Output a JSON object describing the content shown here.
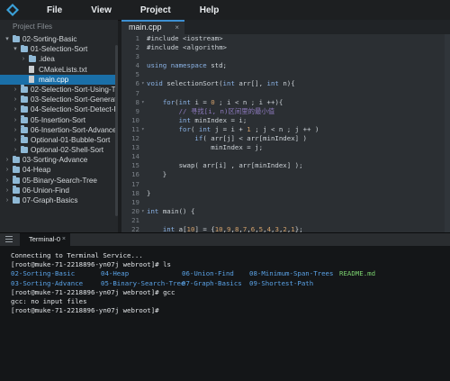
{
  "menu": {
    "items": [
      "File",
      "View",
      "Project",
      "Help"
    ]
  },
  "sidebar": {
    "header": "Project Files",
    "items": [
      {
        "label": "02-Sorting-Basic",
        "level": 0,
        "type": "folder",
        "expanded": true,
        "selected": false
      },
      {
        "label": "01-Selection-Sort",
        "level": 1,
        "type": "folder",
        "expanded": true,
        "selected": false
      },
      {
        "label": ".idea",
        "level": 2,
        "type": "folder",
        "expanded": false,
        "selected": false
      },
      {
        "label": "CMakeLists.txt",
        "level": 2,
        "type": "file",
        "selected": false
      },
      {
        "label": "main.cpp",
        "level": 2,
        "type": "file",
        "selected": true
      },
      {
        "label": "02-Selection-Sort-Using-Te",
        "level": 1,
        "type": "folder",
        "expanded": false,
        "selected": false
      },
      {
        "label": "03-Selection-Sort-Generate",
        "level": 1,
        "type": "folder",
        "expanded": false,
        "selected": false
      },
      {
        "label": "04-Selection-Sort-Detect-P",
        "level": 1,
        "type": "folder",
        "expanded": false,
        "selected": false
      },
      {
        "label": "05-Insertion-Sort",
        "level": 1,
        "type": "folder",
        "expanded": false,
        "selected": false
      },
      {
        "label": "06-Insertion-Sort-Advance",
        "level": 1,
        "type": "folder",
        "expanded": false,
        "selected": false
      },
      {
        "label": "Optional-01-Bubble-Sort",
        "level": 1,
        "type": "folder",
        "expanded": false,
        "selected": false
      },
      {
        "label": "Optional-02-Shell-Sort",
        "level": 1,
        "type": "folder",
        "expanded": false,
        "selected": false
      },
      {
        "label": "03-Sorting-Advance",
        "level": 0,
        "type": "folder",
        "expanded": false,
        "selected": false
      },
      {
        "label": "04-Heap",
        "level": 0,
        "type": "folder",
        "expanded": false,
        "selected": false
      },
      {
        "label": "05-Binary-Search-Tree",
        "level": 0,
        "type": "folder",
        "expanded": false,
        "selected": false
      },
      {
        "label": "06-Union-Find",
        "level": 0,
        "type": "folder",
        "expanded": false,
        "selected": false
      },
      {
        "label": "07-Graph-Basics",
        "level": 0,
        "type": "folder",
        "expanded": false,
        "selected": false
      }
    ]
  },
  "editor": {
    "tab": {
      "label": "main.cpp",
      "close": "×"
    },
    "lines": [
      {
        "n": "1",
        "fold": "",
        "t": [
          [
            "#include <iostream>",
            "pp"
          ]
        ]
      },
      {
        "n": "2",
        "fold": "",
        "t": [
          [
            "#include <algorithm>",
            "pp"
          ]
        ]
      },
      {
        "n": "3",
        "fold": "",
        "t": []
      },
      {
        "n": "4",
        "fold": "",
        "t": [
          [
            "using ",
            "kw"
          ],
          [
            "namespace ",
            "kw"
          ],
          [
            "std;",
            ""
          ]
        ]
      },
      {
        "n": "5",
        "fold": "",
        "t": []
      },
      {
        "n": "6",
        "fold": "▾",
        "t": [
          [
            "void ",
            "kw"
          ],
          [
            "selectionSort(",
            ""
          ],
          [
            "int ",
            "kw"
          ],
          [
            "arr[], ",
            ""
          ],
          [
            "int ",
            "kw"
          ],
          [
            "n){",
            ""
          ]
        ]
      },
      {
        "n": "7",
        "fold": "",
        "t": []
      },
      {
        "n": "8",
        "fold": "▾",
        "t": [
          [
            "    ",
            ""
          ],
          [
            "for",
            "kw"
          ],
          [
            "(",
            ""
          ],
          [
            "int ",
            "kw"
          ],
          [
            "i = ",
            ""
          ],
          [
            "0",
            "num"
          ],
          [
            " ; i < n ; i ++){",
            ""
          ]
        ]
      },
      {
        "n": "9",
        "fold": "",
        "t": [
          [
            "        ",
            ""
          ],
          [
            "// 寻找[i, n)区间里的最小值",
            "cm"
          ]
        ]
      },
      {
        "n": "10",
        "fold": "",
        "t": [
          [
            "        ",
            ""
          ],
          [
            "int ",
            "kw"
          ],
          [
            "minIndex = i;",
            ""
          ]
        ]
      },
      {
        "n": "11",
        "fold": "▾",
        "t": [
          [
            "        ",
            ""
          ],
          [
            "for",
            "kw"
          ],
          [
            "( ",
            ""
          ],
          [
            "int ",
            "kw"
          ],
          [
            "j = i + ",
            ""
          ],
          [
            "1",
            "num"
          ],
          [
            " ; j < n ; j ++ )",
            ""
          ]
        ]
      },
      {
        "n": "12",
        "fold": "",
        "t": [
          [
            "            ",
            ""
          ],
          [
            "if",
            "kw"
          ],
          [
            "( arr[j] < arr[minIndex] )",
            ""
          ]
        ]
      },
      {
        "n": "13",
        "fold": "",
        "t": [
          [
            "                minIndex = j;",
            ""
          ]
        ]
      },
      {
        "n": "14",
        "fold": "",
        "t": []
      },
      {
        "n": "15",
        "fold": "",
        "t": [
          [
            "        swap( arr[i] , arr[minIndex] );",
            ""
          ]
        ]
      },
      {
        "n": "16",
        "fold": "",
        "t": [
          [
            "    }",
            ""
          ]
        ]
      },
      {
        "n": "17",
        "fold": "",
        "t": []
      },
      {
        "n": "18",
        "fold": "",
        "t": [
          [
            "}",
            ""
          ]
        ]
      },
      {
        "n": "19",
        "fold": "",
        "t": []
      },
      {
        "n": "20",
        "fold": "▾",
        "t": [
          [
            "int ",
            "kw"
          ],
          [
            "main() {",
            ""
          ]
        ]
      },
      {
        "n": "21",
        "fold": "",
        "t": []
      },
      {
        "n": "22",
        "fold": "",
        "t": [
          [
            "    ",
            ""
          ],
          [
            "int ",
            "kw"
          ],
          [
            "a[",
            ""
          ],
          [
            "10",
            "num"
          ],
          [
            "] = {",
            ""
          ],
          [
            "10",
            "num"
          ],
          [
            ",",
            ""
          ],
          [
            "9",
            "num"
          ],
          [
            ",",
            ""
          ],
          [
            "8",
            "num"
          ],
          [
            ",",
            ""
          ],
          [
            "7",
            "num"
          ],
          [
            ",",
            ""
          ],
          [
            "6",
            "num"
          ],
          [
            ",",
            ""
          ],
          [
            "5",
            "num"
          ],
          [
            ",",
            ""
          ],
          [
            "4",
            "num"
          ],
          [
            ",",
            ""
          ],
          [
            "3",
            "num"
          ],
          [
            ",",
            ""
          ],
          [
            "2",
            "num"
          ],
          [
            ",",
            ""
          ],
          [
            "1",
            "num"
          ],
          [
            "};",
            ""
          ]
        ]
      }
    ]
  },
  "terminal": {
    "tab_label": "Terminal-0",
    "tab_close": "×",
    "prompt": "[root@muke-71-2218896-yn07j webroot]#",
    "lines": [
      {
        "kind": "text",
        "text": "Connecting to Terminal Service..."
      },
      {
        "kind": "text",
        "text": "[root@muke-71-2218896-yn07j webroot]# ls"
      },
      {
        "kind": "ls",
        "cells": [
          [
            "02-Sorting-Basic",
            "dir",
            0
          ],
          [
            "04-Heap",
            "dir",
            100
          ],
          [
            "06-Union-Find",
            "dir",
            190
          ],
          [
            "08-Minimum-Span-Trees",
            "dir",
            265
          ],
          [
            "README.md",
            "md",
            365
          ]
        ]
      },
      {
        "kind": "ls",
        "cells": [
          [
            "03-Sorting-Advance",
            "dir",
            0
          ],
          [
            "05-Binary-Search-Tree",
            "dir",
            100
          ],
          [
            "07-Graph-Basics",
            "dir",
            190
          ],
          [
            "09-Shortest-Path",
            "dir",
            265
          ]
        ]
      },
      {
        "kind": "text",
        "text": "[root@muke-71-2218896-yn07j webroot]# gcc"
      },
      {
        "kind": "text",
        "text": "gcc: no input files"
      },
      {
        "kind": "text",
        "text": "[root@muke-71-2218896-yn07j webroot]#"
      }
    ]
  },
  "colors": {
    "accent": "#3d8fd1",
    "selected": "#1a6fa8",
    "dir": "#5aa2e6",
    "md": "#7ad06e",
    "keyword": "#8bb3e6",
    "comment": "#8f7bc0",
    "number": "#d3a16b"
  }
}
